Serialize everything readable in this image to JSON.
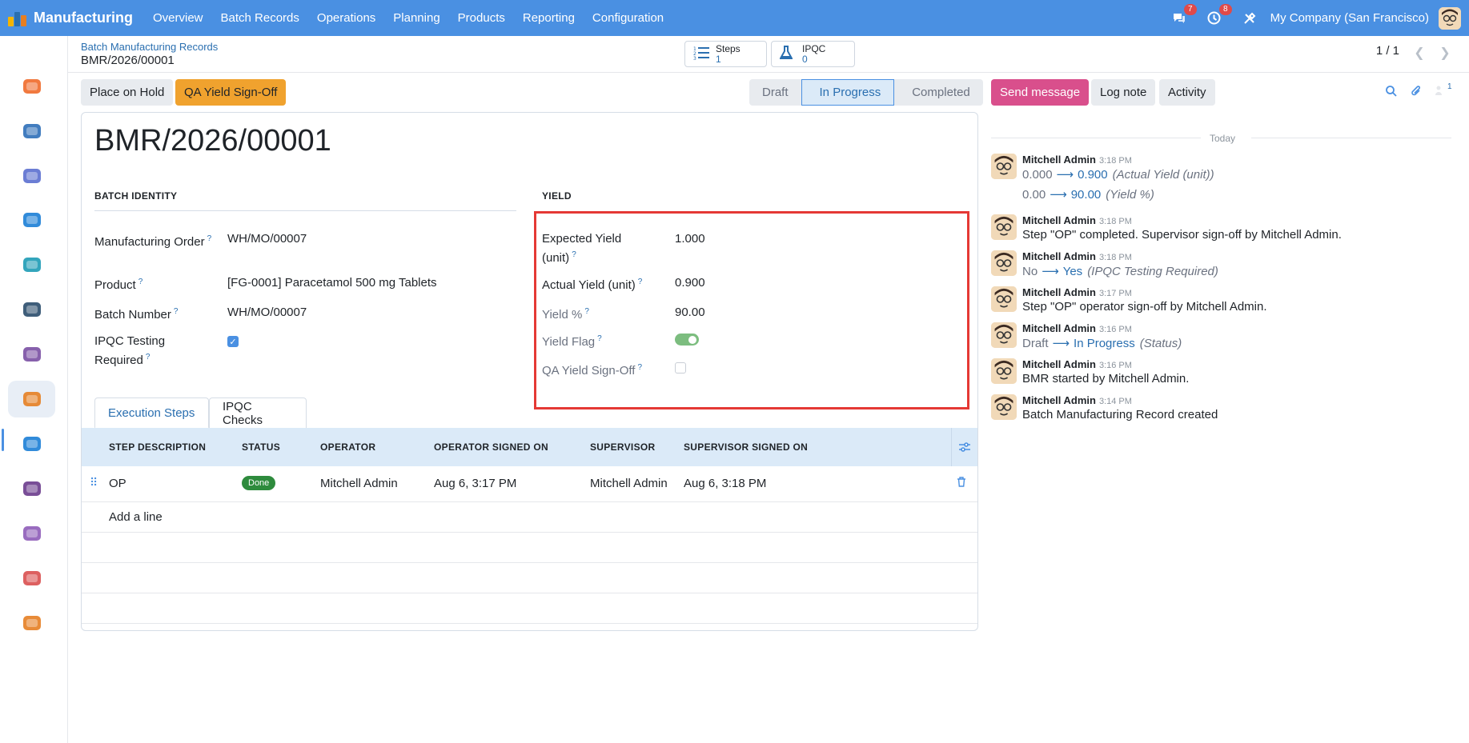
{
  "navbar": {
    "app_name": "Manufacturing",
    "menu": [
      "Overview",
      "Batch Records",
      "Operations",
      "Planning",
      "Products",
      "Reporting",
      "Configuration"
    ],
    "messages_badge": "7",
    "activities_badge": "8",
    "company": "My Company (San Francisco)"
  },
  "sidebar": {
    "apps": [
      {
        "icon": "discuss-icon",
        "color": "#f06a2a"
      },
      {
        "icon": "dashboard-icon",
        "color": "#2d6fb8"
      },
      {
        "icon": "crm-icon",
        "color": "#5b6fcf"
      },
      {
        "icon": "invoicing-icon",
        "color": "#1b7ed6"
      },
      {
        "icon": "website-icon",
        "color": "#1d9bb5"
      },
      {
        "icon": "sales-icon",
        "color": "#2a4d6b"
      },
      {
        "icon": "inventory-icon",
        "color": "#7a4fa3"
      },
      {
        "icon": "manufacturing-icon",
        "color": "#e67e22"
      },
      {
        "icon": "purchase-icon",
        "color": "#1b7ed6"
      },
      {
        "icon": "barcode-icon",
        "color": "#6a3b8c"
      },
      {
        "icon": "employees-icon",
        "color": "#8e5cb8"
      },
      {
        "icon": "quality-icon",
        "color": "#d94f4f"
      },
      {
        "icon": "apps-icon",
        "color": "#e67e22"
      }
    ]
  },
  "control_panel": {
    "breadcrumb_parent": "Batch Manufacturing Records",
    "breadcrumb_current": "BMR/2026/00001",
    "smart_buttons": [
      {
        "label": "Steps",
        "value": "1"
      },
      {
        "label": "IPQC",
        "value": "0"
      }
    ],
    "pager": "1 / 1"
  },
  "header": {
    "buttons": [
      "Place on Hold",
      "QA Yield Sign-Off"
    ],
    "statusbar": [
      "Draft",
      "In Progress",
      "Completed"
    ],
    "active_status": "In Progress"
  },
  "form": {
    "title": "BMR/2026/00001",
    "batch_identity": {
      "title": "BATCH IDENTITY",
      "manufacturing_order_label": "Manufacturing Order",
      "manufacturing_order": "WH/MO/00007",
      "product_label": "Product",
      "product": "[FG-0001] Paracetamol 500 mg Tablets",
      "batch_number_label": "Batch Number",
      "batch_number": "WH/MO/00007",
      "ipqc_label": "IPQC Testing Required",
      "ipqc_required": true
    },
    "yield": {
      "title": "YIELD",
      "expected_label": "Expected Yield (unit)",
      "expected": "1.000",
      "actual_label": "Actual Yield (unit)",
      "actual": "0.900",
      "percent_label": "Yield %",
      "percent": "90.00",
      "flag_label": "Yield Flag",
      "flag": true,
      "signoff_label": "QA Yield Sign-Off",
      "signoff": false
    },
    "tabs": [
      "Execution Steps",
      "IPQC Checks"
    ],
    "steps_table": {
      "columns": [
        "STEP DESCRIPTION",
        "STATUS",
        "OPERATOR",
        "OPERATOR SIGNED ON",
        "SUPERVISOR",
        "SUPERVISOR SIGNED ON"
      ],
      "rows": [
        {
          "description": "OP",
          "status": "Done",
          "operator": "Mitchell Admin",
          "operator_signed": "Aug 6, 3:17 PM",
          "supervisor": "Mitchell Admin",
          "supervisor_signed": "Aug 6, 3:18 PM"
        }
      ],
      "add_line": "Add a line"
    }
  },
  "chatter": {
    "buttons": [
      "Send message",
      "Log note",
      "Activity"
    ],
    "followers_count": "1",
    "today": "Today",
    "messages": [
      {
        "author": "Mitchell Admin",
        "time": "3:18 PM",
        "changes": [
          {
            "old": "0.000",
            "new": "0.900",
            "field": "(Actual Yield (unit))"
          },
          {
            "old": "0.00",
            "new": "90.00",
            "field": "(Yield %)"
          }
        ]
      },
      {
        "author": "Mitchell Admin",
        "time": "3:18 PM",
        "text": "Step \"OP\" completed. Supervisor sign-off by Mitchell Admin."
      },
      {
        "author": "Mitchell Admin",
        "time": "3:18 PM",
        "changes": [
          {
            "old": "No",
            "new": "Yes",
            "field": "(IPQC Testing Required)"
          }
        ]
      },
      {
        "author": "Mitchell Admin",
        "time": "3:17 PM",
        "text": "Step \"OP\" operator sign-off by Mitchell Admin."
      },
      {
        "author": "Mitchell Admin",
        "time": "3:16 PM",
        "changes": [
          {
            "old": "Draft",
            "new": "In Progress",
            "field": "(Status)"
          }
        ]
      },
      {
        "author": "Mitchell Admin",
        "time": "3:16 PM",
        "text": "BMR started by Mitchell Admin."
      },
      {
        "author": "Mitchell Admin",
        "time": "3:14 PM",
        "text": "Batch Manufacturing Record created"
      }
    ]
  }
}
